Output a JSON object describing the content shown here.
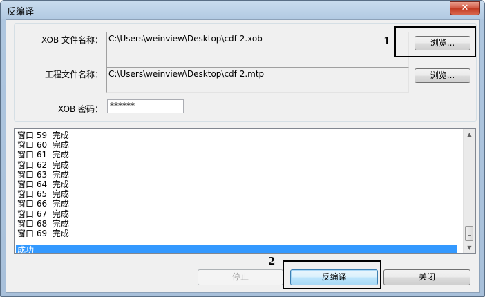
{
  "window": {
    "title": "反编译",
    "close_glyph": "✕"
  },
  "form": {
    "xob_label": "XOB 文件名称：",
    "xob_path": "C:\\Users\\weinview\\Desktop\\cdf 2.xob",
    "browse1_label": "浏览...",
    "project_label": "工程文件名称：",
    "project_path": "C:\\Users\\weinview\\Desktop\\cdf 2.mtp",
    "browse2_label": "浏览...",
    "password_label": "XOB 密码：",
    "password_value": "******"
  },
  "log": {
    "lines": [
      "窗口 59  完成",
      "窗口 60  完成",
      "窗口 61  完成",
      "窗口 62  完成",
      "窗口 63  完成",
      "窗口 64  完成",
      "窗口 65  完成",
      "窗口 66  完成",
      "窗口 67  完成",
      "窗口 68  完成",
      "窗口 69  完成"
    ],
    "selected": "成功"
  },
  "buttons": {
    "stop": "停止",
    "decompile": "反编译",
    "close": "关闭"
  },
  "annotations": {
    "label1": "1",
    "label2": "2"
  }
}
